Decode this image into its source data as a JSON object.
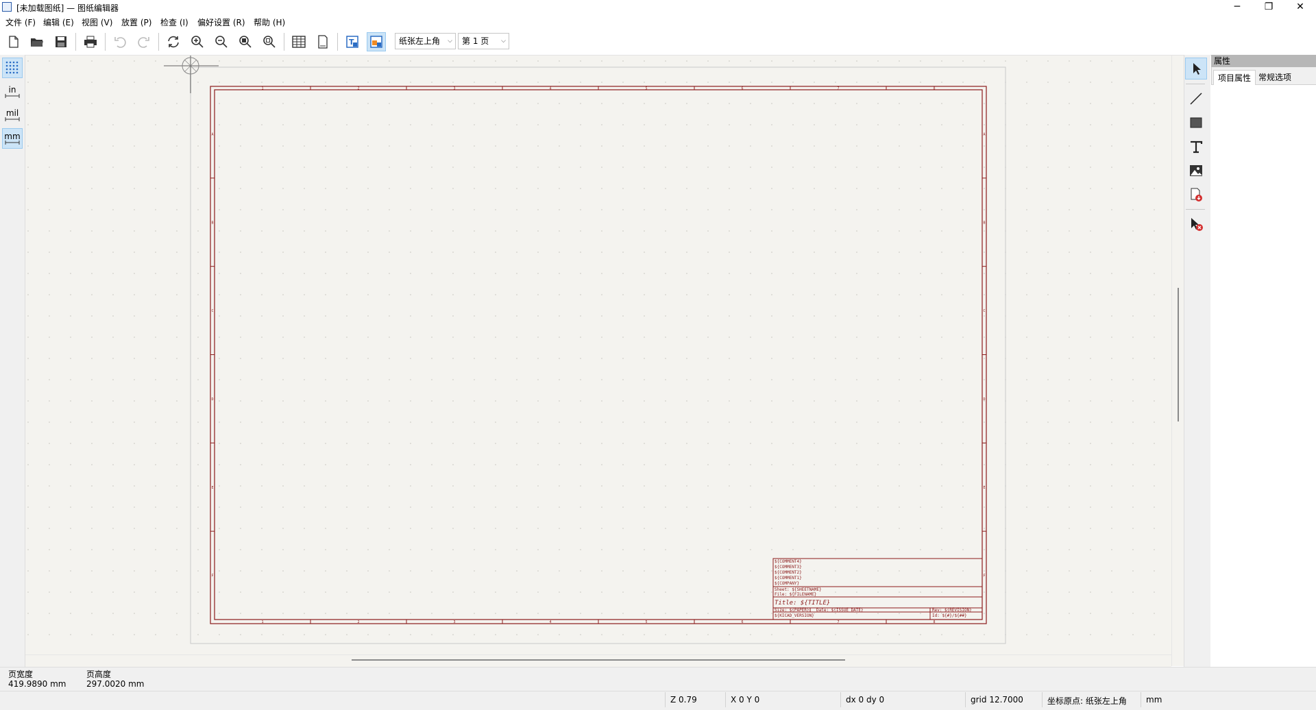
{
  "window": {
    "title": "[未加载图纸] — 图纸编辑器",
    "minimize_glyph": "─",
    "maximize_glyph": "❐",
    "close_glyph": "✕"
  },
  "menu": [
    "文件 (F)",
    "编辑 (E)",
    "视图 (V)",
    "放置 (P)",
    "检查 (I)",
    "偏好设置 (R)",
    "帮助 (H)"
  ],
  "toolbar": {
    "icons": [
      "new-file-icon",
      "open-folder-icon",
      "save-icon",
      "print-icon",
      "undo-icon",
      "redo-icon",
      "refresh-icon",
      "zoom-in-icon",
      "zoom-out-icon",
      "zoom-fit-icon",
      "zoom-selection-icon",
      "table-view-icon",
      "page-portrait-icon",
      "title-block-normal-icon",
      "title-block-edit-icon"
    ],
    "origin_combo": "纸张左上角",
    "page_combo": "第 1 页"
  },
  "left_toolbar": {
    "grid_icon": "grid-dots-icon",
    "units": [
      "in",
      "mil",
      "mm"
    ],
    "active_unit": "mm"
  },
  "right_toolbar": {
    "tools": [
      "select-arrow-icon",
      "line-tool-icon",
      "rectangle-tool-icon",
      "text-tool-icon",
      "image-tool-icon",
      "append-page-icon",
      "delete-tool-icon"
    ]
  },
  "properties": {
    "header": "属性",
    "tabs": [
      "项目属性",
      "常规选项"
    ],
    "active_tab": "项目属性"
  },
  "sheet": {
    "border_color": "#8b1a1a",
    "column_labels": [
      "1",
      "2",
      "3",
      "4",
      "5",
      "6",
      "7",
      "8"
    ],
    "row_labels": [
      "A",
      "B",
      "C",
      "D",
      "E",
      "F"
    ],
    "title_block": {
      "comment4": "${COMMENT4}",
      "comment3": "${COMMENT3}",
      "comment2": "${COMMENT2}",
      "comment1": "${COMMENT1}",
      "company": "${COMPANY}",
      "sheet": "Sheet: ${SHEETNAME}",
      "file": "File: ${FILENAME}",
      "title": "Title: ${TITLE}",
      "size": "Size: ${PAPER}",
      "date": "Date: ${ISSUE_DATE}",
      "rev": "Rev: ${REVISION}",
      "kicad": "${KICAD_VERSION}",
      "id": "Id: ${#}/${##}"
    }
  },
  "info": {
    "width_label": "页宽度",
    "width_value": "419.9890 mm",
    "height_label": "页高度",
    "height_value": "297.0020 mm"
  },
  "status": {
    "zoom": "Z 0.79",
    "xy": "X 0  Y 0",
    "dxdy": "dx 0  dy 0",
    "grid": "grid 12.7000",
    "origin": "坐标原点: 纸张左上角",
    "units": "mm"
  },
  "colors": {
    "canvas": "#f4f3ef",
    "sheet_border": "#8b1a1a",
    "active_button": "#cce4f7"
  }
}
